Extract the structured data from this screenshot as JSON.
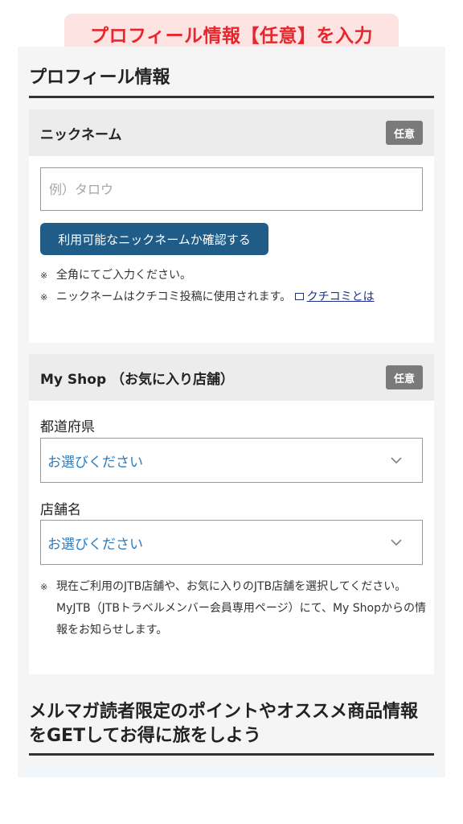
{
  "banner": {
    "text": "プロフィール情報【任意】を入力"
  },
  "profile": {
    "title": "プロフィール情報",
    "nickname": {
      "header": "ニックネーム",
      "badge": "任意",
      "placeholder": "例）タロウ",
      "value": "",
      "check_button": "利用可能なニックネームか確認する",
      "note1": "全角にてご入力ください。",
      "note2_text": "ニックネームはクチコミ投稿に使用されます。",
      "note2_link": "クチコミとは"
    },
    "myshop": {
      "header": "My Shop （お気に入り店舗）",
      "badge": "任意",
      "prefecture_label": "都道府県",
      "prefecture_value": "お選びください",
      "store_label": "店舗名",
      "store_value": "お選びください",
      "note_line1": "現在ご利用のJTB店舗や、お気に入りのJTB店舗を選択してください。",
      "note_line2": "MyJTB（JTBトラベルメンバー会員専用ページ）にて、My Shopからの情報をお知らせします。"
    }
  },
  "promo": {
    "title": "メルマガ読者限定のポイントやオススメ商品情報をGETしてお得に旅をしよう"
  },
  "icons": {
    "note_mark": "※",
    "chevron": "chevron-down-icon",
    "external_link": "external-link-icon"
  },
  "colors": {
    "banner_text": "#e8262d",
    "button_bg": "#1f5c87",
    "select_text": "#2a7cc0",
    "link": "#1a2f8a"
  }
}
